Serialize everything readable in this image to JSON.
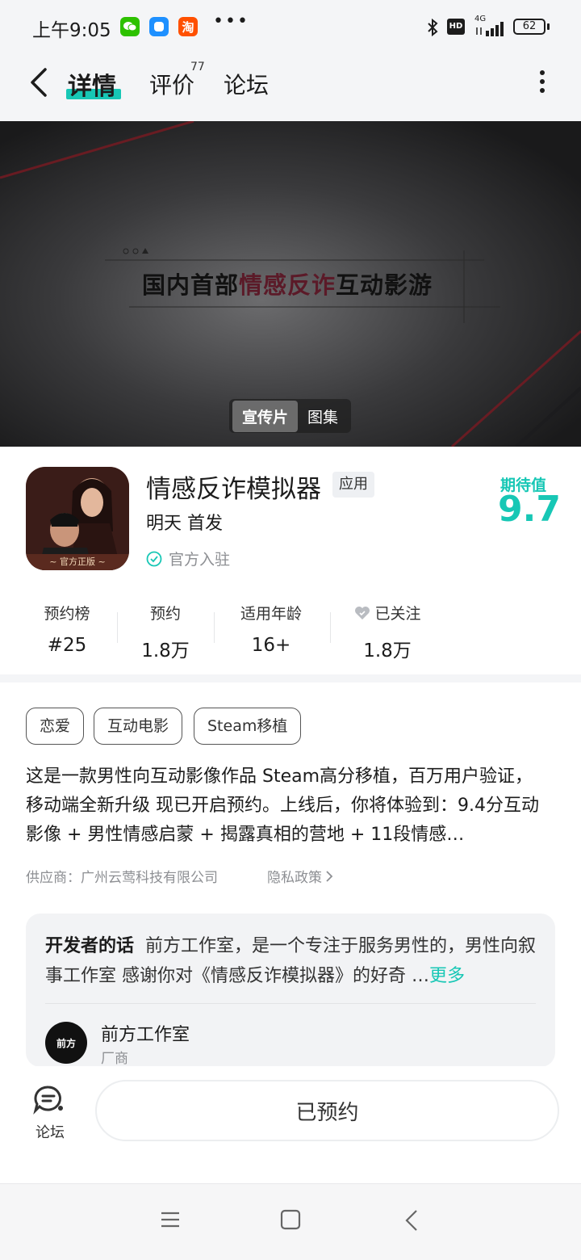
{
  "status": {
    "time": "上午9:05",
    "more": "•••",
    "battery": "62",
    "network": "4G",
    "hd": "HD"
  },
  "nav": {
    "tabs": [
      {
        "label": "详情",
        "active": true
      },
      {
        "label": "评价",
        "count": "77"
      },
      {
        "label": "论坛"
      }
    ]
  },
  "hero": {
    "title_part1": "国内首部",
    "title_part2": "情感反诈",
    "title_part3": "互动影游",
    "toggle": [
      "宣传片",
      "图集"
    ]
  },
  "app": {
    "icon_caption": "~ 官方正版 ~",
    "name": "情感反诈模拟器",
    "tag": "应用",
    "release": "明天 首发",
    "official": "官方入驻",
    "expect_label": "期待值",
    "expect_value": "9.7"
  },
  "stats": [
    {
      "label": "预约榜",
      "value": "#25"
    },
    {
      "label": "预约",
      "value": "1.8万"
    },
    {
      "label": "适用年龄",
      "value": "16+"
    },
    {
      "label": "已关注",
      "value": "1.8万"
    }
  ],
  "tags": [
    "恋爱",
    "互动电影",
    "Steam移植"
  ],
  "description": "这是一款男性向互动影像作品 Steam高分移植，百万用户验证，移动端全新升级 现已开启预约。上线后，你将体验到：9.4分互动影像 + 男性情感启蒙 + 揭露真相的营地 + 11段情感…",
  "supplier": "供应商：广州云莺科技有限公司",
  "privacy": "隐私政策",
  "developer": {
    "label": "开发者的话",
    "text": "前方工作室，是一个专注于服务男性的，男性向叙事工作室 感谢你对《情感反诈模拟器》的好奇 …",
    "more": "更多",
    "name": "前方工作室",
    "role": "厂商",
    "avatar_text": "前方"
  },
  "bottom": {
    "forum_label": "论坛",
    "reserve_label": "已预约"
  },
  "colors": {
    "accent": "#17c7b5"
  }
}
